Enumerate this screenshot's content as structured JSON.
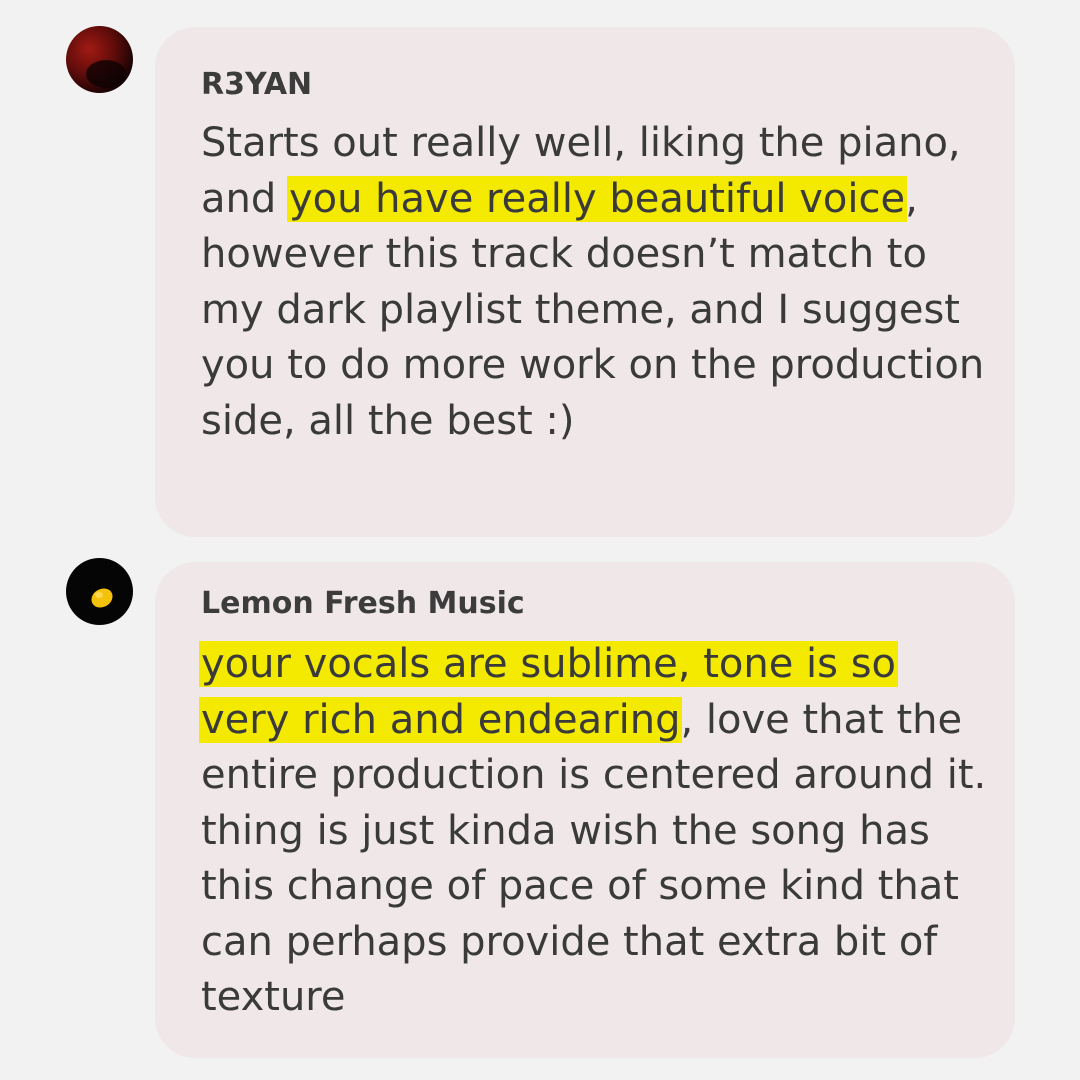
{
  "comments": [
    {
      "author": "R3YAN",
      "text_before": "Starts out really well, liking the piano, and ",
      "text_highlight": "you have really beautiful voice",
      "text_after": ", however this track doesn’t match to my dark playlist theme, and I suggest you to do more work on the production side, all the best :)"
    },
    {
      "author": "Lemon Fresh Music",
      "text_before": "",
      "text_highlight": "your vocals are sublime, tone is so very rich and endearing",
      "text_after": ", love that the entire production is centered around it. thing is just kinda wish the song has this change of pace of some kind that can perhaps provide that extra bit of texture"
    }
  ],
  "colors": {
    "background": "#f2f2f2",
    "bubble": "#f0e8e8",
    "highlight": "#f4ea00",
    "text": "#3a3a3a"
  }
}
